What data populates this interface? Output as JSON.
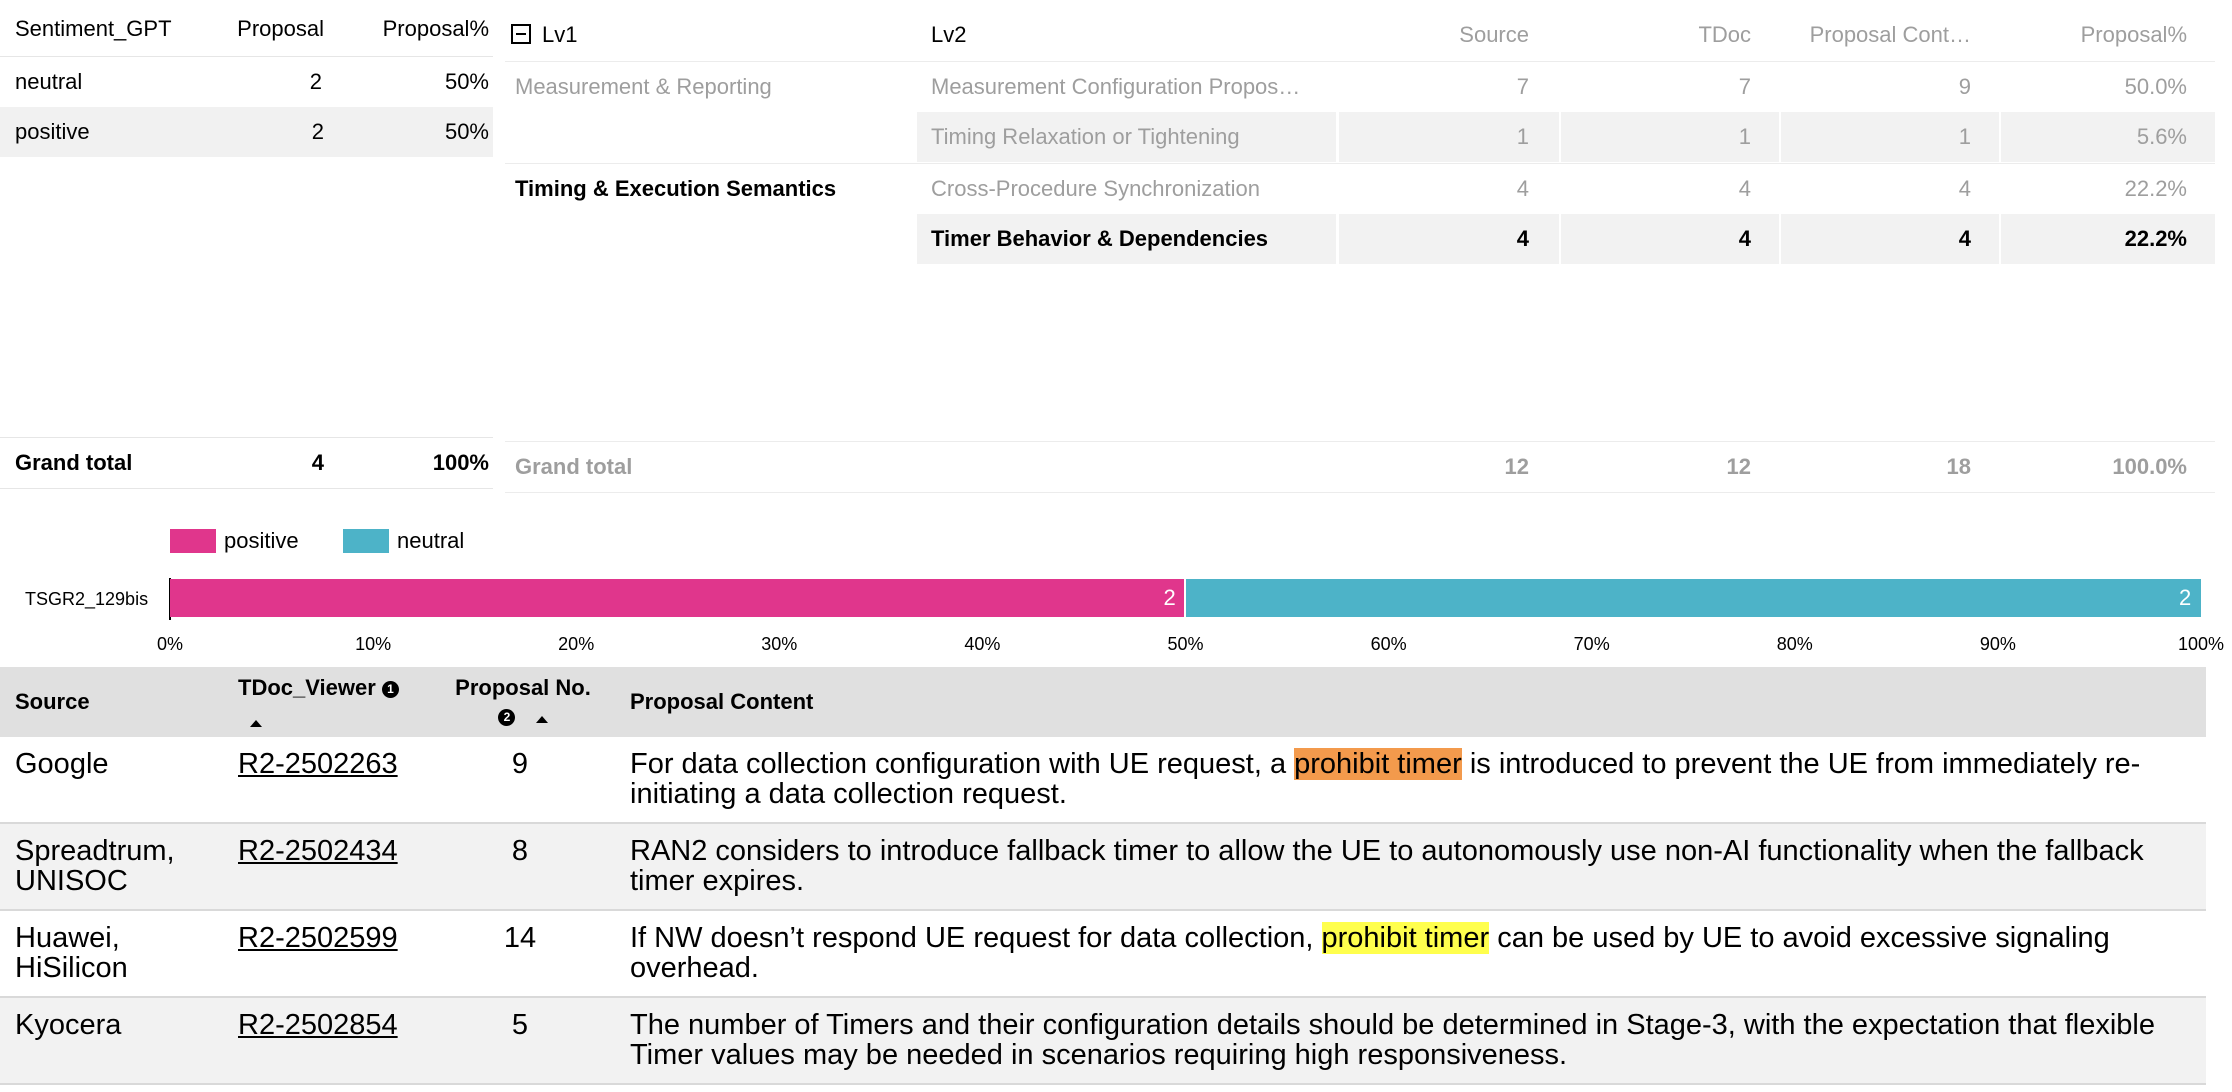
{
  "sentiment_table": {
    "headers": [
      "Sentiment_GPT",
      "Proposal",
      "Proposal%"
    ],
    "rows": [
      {
        "label": "neutral",
        "proposal": "2",
        "pct": "50%"
      },
      {
        "label": "positive",
        "proposal": "2",
        "pct": "50%"
      }
    ],
    "total": {
      "label": "Grand total",
      "proposal": "4",
      "pct": "100%"
    }
  },
  "lv_table": {
    "headers": {
      "lv1": "Lv1",
      "lv2": "Lv2",
      "source": "Source",
      "tdoc": "TDoc",
      "proposal_content": "Proposal Cont…",
      "proposal_pct": "Proposal%"
    },
    "rows": [
      {
        "lv1": "Measurement & Reporting",
        "lv2": "Measurement Configuration Propos…",
        "source": "7",
        "tdoc": "7",
        "proposal_content": "9",
        "proposal_pct": "50.0%"
      },
      {
        "lv1": "",
        "lv2": "Timing Relaxation or Tightening",
        "source": "1",
        "tdoc": "1",
        "proposal_content": "1",
        "proposal_pct": "5.6%"
      },
      {
        "lv1": "Timing & Execution Semantics",
        "lv2": "Cross-Procedure Synchronization",
        "source": "4",
        "tdoc": "4",
        "proposal_content": "4",
        "proposal_pct": "22.2%"
      },
      {
        "lv1": "",
        "lv2": "Timer Behavior & Dependencies",
        "source": "4",
        "tdoc": "4",
        "proposal_content": "4",
        "proposal_pct": "22.2%"
      }
    ],
    "total": {
      "label": "Grand total",
      "source": "12",
      "tdoc": "12",
      "proposal_content": "18",
      "proposal_pct": "100.0%"
    }
  },
  "chart_data": {
    "type": "bar",
    "orientation": "horizontal",
    "stacked": true,
    "normalized_percent": true,
    "categories": [
      "TSGR2_129bis"
    ],
    "series": [
      {
        "name": "positive",
        "values": [
          2
        ],
        "color": "#e0368c"
      },
      {
        "name": "neutral",
        "values": [
          2
        ],
        "color": "#4db3c8"
      }
    ],
    "x_ticks": [
      "0%",
      "10%",
      "20%",
      "30%",
      "40%",
      "50%",
      "60%",
      "70%",
      "80%",
      "90%",
      "100%"
    ],
    "xlim": [
      0,
      100
    ],
    "legend": "top-left",
    "grid": false
  },
  "proposal_table": {
    "headers": {
      "source": "Source",
      "tdoc": "TDoc_Viewer",
      "tdoc_badge": "1",
      "proposal_no": "Proposal No.",
      "proposal_no_badge": "2",
      "content": "Proposal Content"
    },
    "rows": [
      {
        "source": "Google",
        "tdoc": "R2-2502263",
        "no": "9",
        "content_before": "For data collection configuration with UE request, a ",
        "highlight": "prohibit timer",
        "highlight_color": "orange",
        "content_after": " is introduced to prevent the UE from immediately re-initiating a data collection request."
      },
      {
        "source": "Spreadtrum, UNISOC",
        "tdoc": "R2-2502434",
        "no": "8",
        "content_before": "RAN2 considers to introduce fallback timer to allow the UE to autonomously use non-AI functionality when the fallback timer expires.",
        "highlight": "",
        "highlight_color": "",
        "content_after": ""
      },
      {
        "source": "Huawei, HiSilicon",
        "tdoc": "R2-2502599",
        "no": "14",
        "content_before": "If NW doesn’t respond UE request for data collection, ",
        "highlight": "prohibit timer",
        "highlight_color": "yellow",
        "content_after": " can be used by UE to avoid excessive signaling overhead."
      },
      {
        "source": "Kyocera",
        "tdoc": "R2-2502854",
        "no": "5",
        "content_before": "The number of Timers and their configuration details should be determined in Stage-3, with the expectation that flexible Timer values may be needed in scenarios requiring high responsiveness.",
        "highlight": "",
        "highlight_color": "",
        "content_after": ""
      }
    ]
  }
}
